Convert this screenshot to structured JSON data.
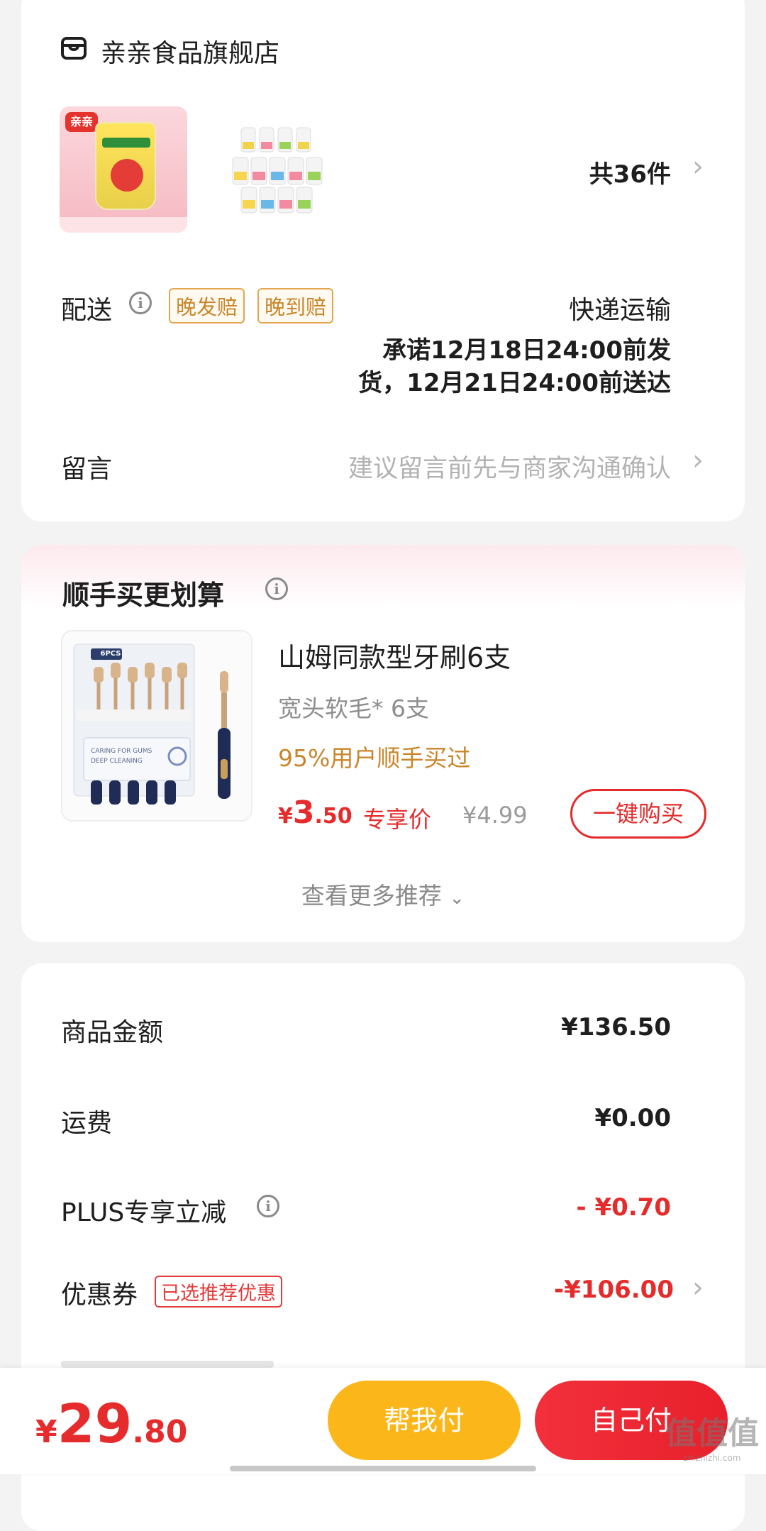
{
  "store": {
    "name": "亲亲食品旗舰店",
    "item_count": "共36件"
  },
  "shipping": {
    "label": "配送",
    "tag_late_ship": "晚发赔",
    "tag_late_arrive": "晚到赔",
    "method": "快递运输",
    "promise_line1": "承诺12月18日24:00前发",
    "promise_line2": "货，12月21日24:00前送达"
  },
  "message": {
    "label": "留言",
    "placeholder": "建议留言前先与商家沟通确认"
  },
  "recommend": {
    "title": "顺手买更划算",
    "product": {
      "image_badge": "6PCS",
      "image_line1": "CARING FOR GUMS",
      "image_line2": "DEEP CLEANING",
      "name": "山姆同款型牙刷6支",
      "spec": "宽头软毛* 6支",
      "social_proof": "95%用户顺手买过",
      "price_symbol": "¥",
      "price_int": "3",
      "price_dec": ".50",
      "price_label": "专享价",
      "original_price": "¥4.99",
      "buy_button": "一键购买"
    },
    "more": "查看更多推荐"
  },
  "summary": {
    "goods_amount_label": "商品金额",
    "goods_amount": "¥136.50",
    "freight_label": "运费",
    "freight": "¥0.00",
    "plus_label": "PLUS专享立减",
    "plus_value": "- ¥0.70",
    "coupon_label": "优惠券",
    "coupon_tag": "已选推荐优惠",
    "coupon_value": "-¥106.00"
  },
  "footer": {
    "total_symbol": "¥",
    "total_int": "29",
    "total_dec": ".80",
    "help_pay": "帮我付",
    "self_pay": "自己付",
    "watermark": "值值值",
    "watermark_url": "zhizhizhi.com"
  },
  "colors": {
    "accent_red": "#e52b2b",
    "accent_orange": "#c9862a",
    "help_pay_bg": "#fbb71a",
    "self_pay_bg": "#f2303c"
  }
}
